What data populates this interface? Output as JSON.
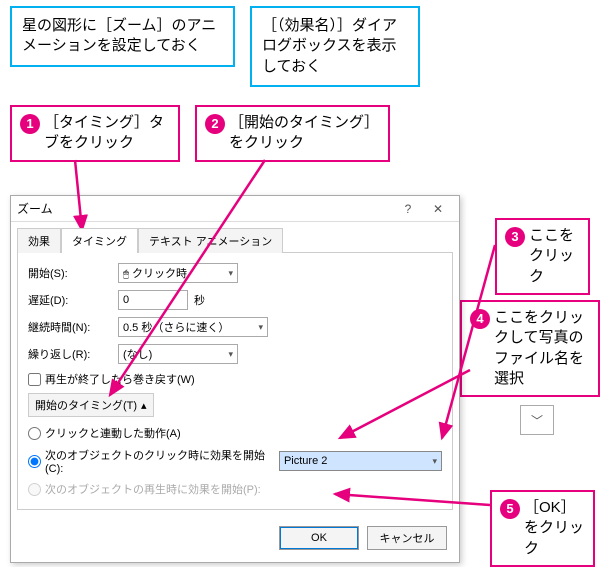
{
  "callouts_top": {
    "left": "星の図形に［ズーム］のアニメーションを設定しておく",
    "right": "［（効果名）］ダイアログボックスを表示しておく"
  },
  "steps": {
    "s1": "［タイミング］タブをクリック",
    "s2": "［開始のタイミング］をクリック",
    "s3": "ここをクリック",
    "s4": "ここをクリックして写真のファイル名を選択",
    "s5": "［OK］をクリック"
  },
  "dialog": {
    "title": "ズーム",
    "tabs": {
      "effect": "効果",
      "timing": "タイミング",
      "text": "テキスト アニメーション"
    },
    "start_label": "開始(S):",
    "start_value": "クリック時",
    "delay_label": "遅延(D):",
    "delay_value": "0",
    "delay_unit": "秒",
    "duration_label": "継続時間(N):",
    "duration_value": "0.5 秒（さらに速く）",
    "repeat_label": "繰り返し(R):",
    "repeat_value": "(なし)",
    "rewind_label": "再生が終了したら巻き戻す(W)",
    "trigger_btn": "開始のタイミング(T)",
    "radio1": "クリックと連動した動作(A)",
    "radio2": "次のオブジェクトのクリック時に効果を開始(C):",
    "radio3": "次のオブジェクトの再生時に効果を開始(P):",
    "trigger_value": "Picture 2",
    "ok": "OK",
    "cancel": "キャンセル"
  }
}
